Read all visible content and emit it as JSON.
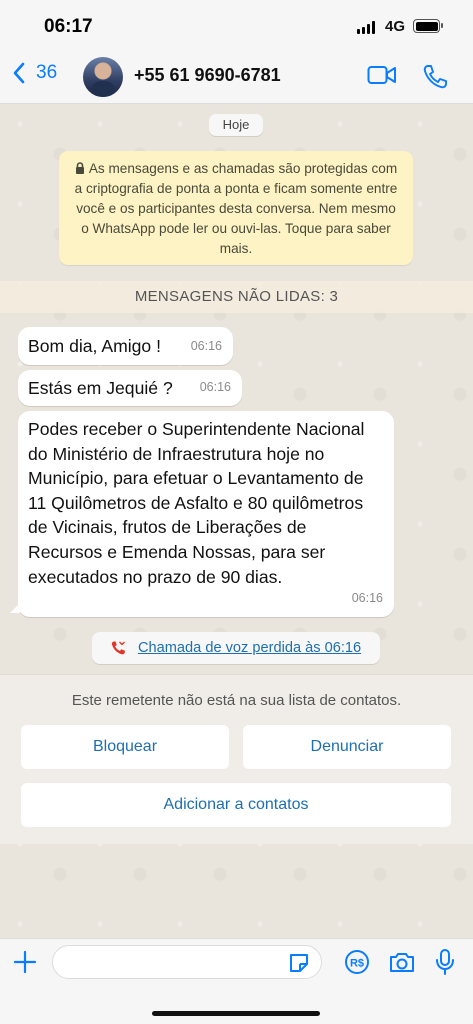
{
  "status_bar": {
    "time": "06:17",
    "network": "4G"
  },
  "header": {
    "back_count": "36",
    "contact": "+55 61 9690-6781"
  },
  "chat": {
    "date_chip": "Hoje",
    "encryption_notice": "As mensagens e as chamadas são protegidas com a criptografia de ponta a ponta e ficam somente entre você e os participantes desta conversa. Nem mesmo o WhatsApp pode ler ou ouvi-las. Toque para saber mais.",
    "unread_banner": "MENSAGENS NÃO LIDAS: 3",
    "messages": [
      {
        "text": "Bom dia, Amigo !",
        "time": "06:16"
      },
      {
        "text": "Estás em Jequié ?",
        "time": "06:16"
      },
      {
        "text": "Podes receber o Superintendente Nacional do Ministério de Infraestrutura hoje no Município, para efetuar o Levantamento de 11 Quilômetros de Asfalto e 80 quilômetros de Vicinais, frutos de Liberações de Recursos e Emenda Nossas, para ser executados no prazo de 90 dias.",
        "time": "06:16"
      }
    ],
    "missed_call": "Chamada de voz perdida às 06:16"
  },
  "unknown_sender": {
    "notice": "Este remetente não está na sua lista de contatos.",
    "block_label": "Bloquear",
    "report_label": "Denunciar",
    "add_label": "Adicionar a contatos"
  },
  "input_bar": {
    "placeholder": ""
  },
  "colors": {
    "accent": "#0a7cff",
    "link": "#1f6fb0",
    "missed_call_icon": "#e0352b",
    "encryption_bg": "#fdf3c4",
    "chat_bg": "#e9e4dc"
  },
  "icons": [
    "chevron-left-icon",
    "video-icon",
    "phone-icon",
    "lock-icon",
    "missed-call-icon",
    "plus-icon",
    "sticker-icon",
    "pix-icon",
    "camera-icon",
    "microphone-icon"
  ]
}
